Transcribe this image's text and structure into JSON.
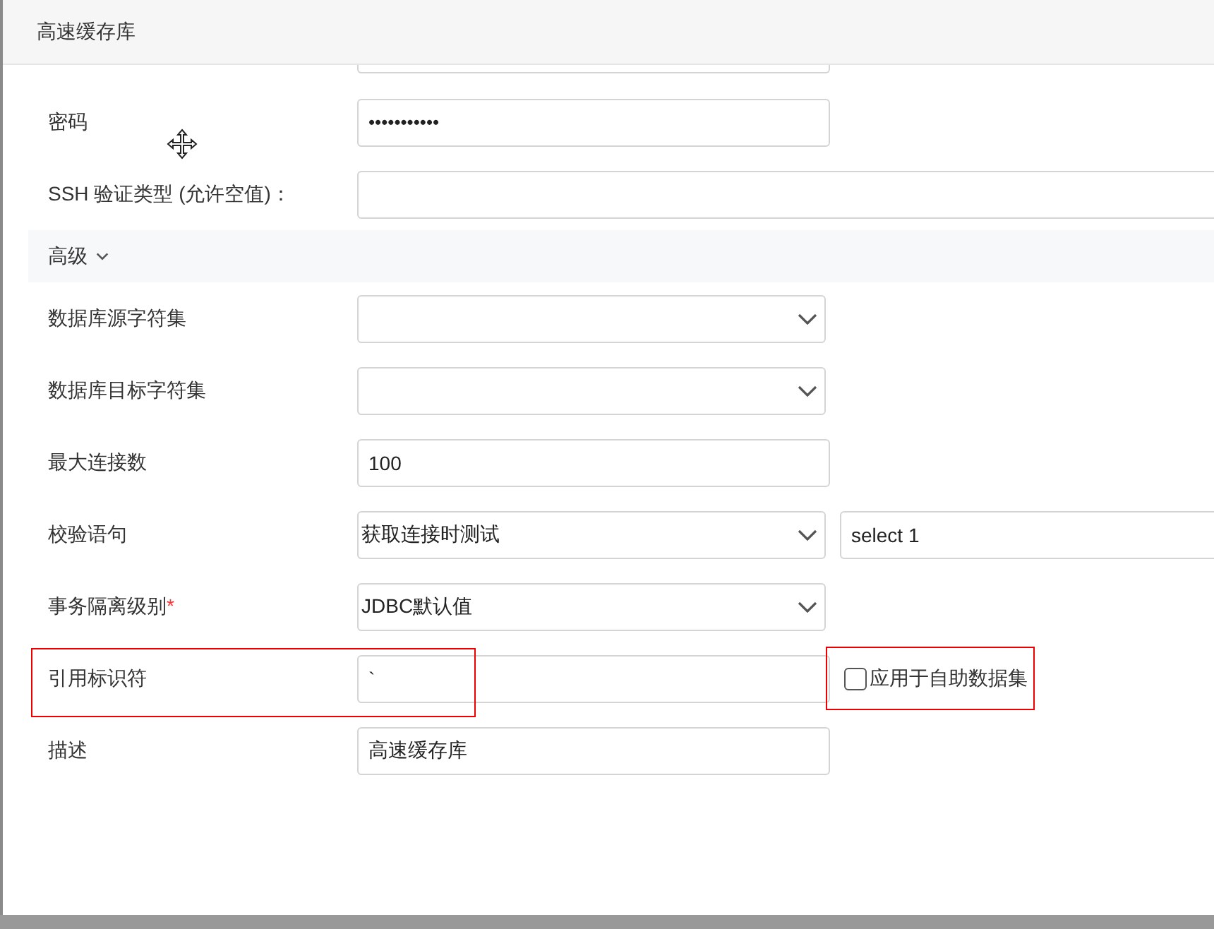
{
  "window": {
    "title": "高速缓存库"
  },
  "rows": [
    {
      "label": "密码",
      "kind": "password",
      "value": "•••••••••••"
    },
    {
      "label": "SSH 验证类型 (允许空值)：",
      "kind": "long_text"
    }
  ],
  "advanced": {
    "label": "高级",
    "expanded": true,
    "rows": [
      {
        "label": "数据库源字符集",
        "kind": "select"
      },
      {
        "label": "数据库目标字符集",
        "kind": "select"
      },
      {
        "label": "最大连接数",
        "kind": "text",
        "value": "100"
      },
      {
        "label": "校验语句",
        "kind": "select",
        "value": "获取连接时测试",
        "extra_field": {
          "value": "select 1"
        }
      },
      {
        "label": "事务隔离级别",
        "required_mark": "*",
        "kind": "select",
        "value": "JDBC默认值"
      },
      {
        "label": "引用标识符",
        "kind": "text",
        "value": "`",
        "highlighted": true,
        "option": {
          "label": "应用于自助数据集",
          "checked": false,
          "highlighted": true
        }
      },
      {
        "label": "描述",
        "kind": "text",
        "value": "高速缓存库"
      }
    ]
  }
}
